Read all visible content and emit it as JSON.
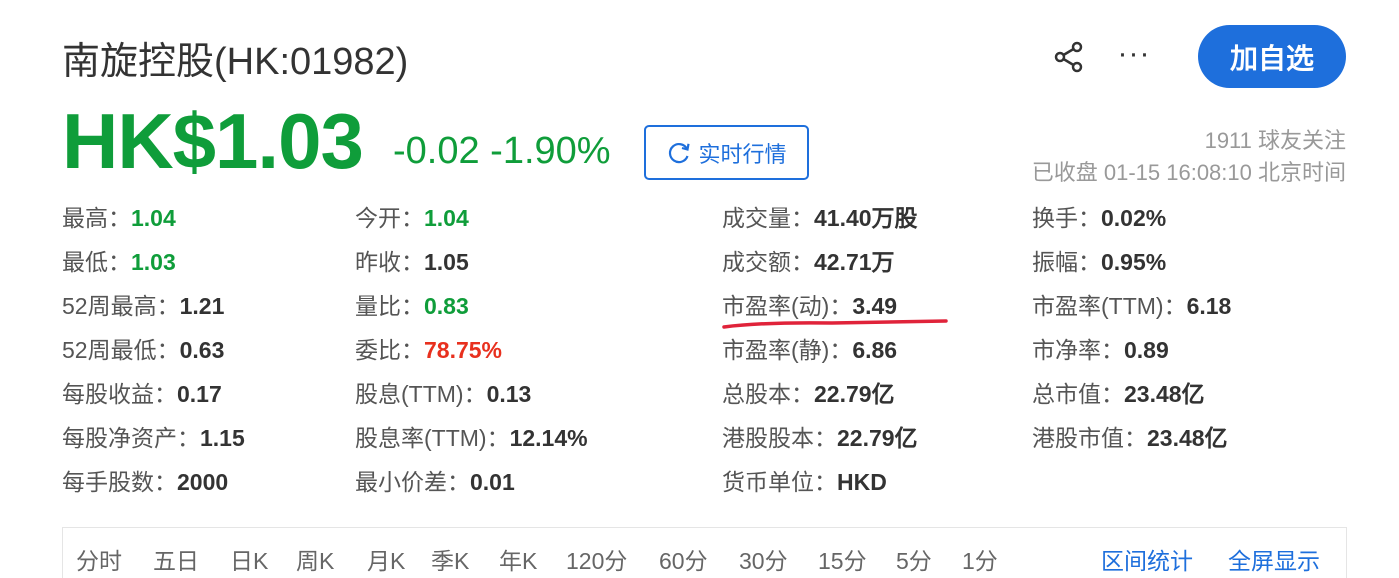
{
  "header": {
    "title": "南旋控股(HK:01982)",
    "follow_label": "加自选",
    "more_label": "···"
  },
  "quote": {
    "price": "HK$1.03",
    "change": "-0.02 -1.90%",
    "realtime_label": "实时行情",
    "followers": "1911 球友关注",
    "status": "已收盘 01-15 16:08:10 北京时间"
  },
  "stats": [
    [
      {
        "label": "最高：",
        "value": "1.04",
        "color": "green"
      },
      {
        "label": "最低：",
        "value": "1.03",
        "color": "green"
      },
      {
        "label": "52周最高：",
        "value": "1.21",
        "color": ""
      },
      {
        "label": "52周最低：",
        "value": "0.63",
        "color": ""
      },
      {
        "label": "每股收益：",
        "value": "0.17",
        "color": ""
      },
      {
        "label": "每股净资产：",
        "value": "1.15",
        "color": ""
      },
      {
        "label": "每手股数：",
        "value": "2000",
        "color": ""
      }
    ],
    [
      {
        "label": "今开：",
        "value": "1.04",
        "color": "green"
      },
      {
        "label": "昨收：",
        "value": "1.05",
        "color": ""
      },
      {
        "label": "量比：",
        "value": "0.83",
        "color": "green"
      },
      {
        "label": "委比：",
        "value": "78.75%",
        "color": "red"
      },
      {
        "label": "股息(TTM)：",
        "value": "0.13",
        "color": ""
      },
      {
        "label": "股息率(TTM)：",
        "value": "12.14%",
        "color": ""
      },
      {
        "label": "最小价差：",
        "value": "0.01",
        "color": ""
      }
    ],
    [
      {
        "label": "成交量：",
        "value": "41.40万股",
        "color": ""
      },
      {
        "label": "成交额：",
        "value": "42.71万",
        "color": ""
      },
      {
        "label": "市盈率(动)：",
        "value": "3.49",
        "color": ""
      },
      {
        "label": "市盈率(静)：",
        "value": "6.86",
        "color": ""
      },
      {
        "label": "总股本：",
        "value": "22.79亿",
        "color": ""
      },
      {
        "label": "港股股本：",
        "value": "22.79亿",
        "color": ""
      },
      {
        "label": "货币单位：",
        "value": "HKD",
        "color": ""
      }
    ],
    [
      {
        "label": "换手：",
        "value": "0.02%",
        "color": ""
      },
      {
        "label": "振幅：",
        "value": "0.95%",
        "color": ""
      },
      {
        "label": "市盈率(TTM)：",
        "value": "6.18",
        "color": ""
      },
      {
        "label": "市净率：",
        "value": "0.89",
        "color": ""
      },
      {
        "label": "总市值：",
        "value": "23.48亿",
        "color": ""
      },
      {
        "label": "港股市值：",
        "value": "23.48亿",
        "color": ""
      }
    ]
  ],
  "period_tabs": [
    "分时",
    "五日",
    "日K",
    "周K",
    "月K",
    "季K",
    "年K",
    "120分",
    "60分",
    "30分",
    "15分",
    "5分",
    "1分"
  ],
  "tab_links": [
    "区间统计",
    "全屏显示"
  ],
  "icons": {
    "share": "share-icon",
    "refresh": "refresh-icon"
  },
  "colors": {
    "down_green": "#0f9d3a",
    "up_red": "#e8301e",
    "accent_blue": "#1e6fdc",
    "annotation_red": "#e0233a"
  }
}
